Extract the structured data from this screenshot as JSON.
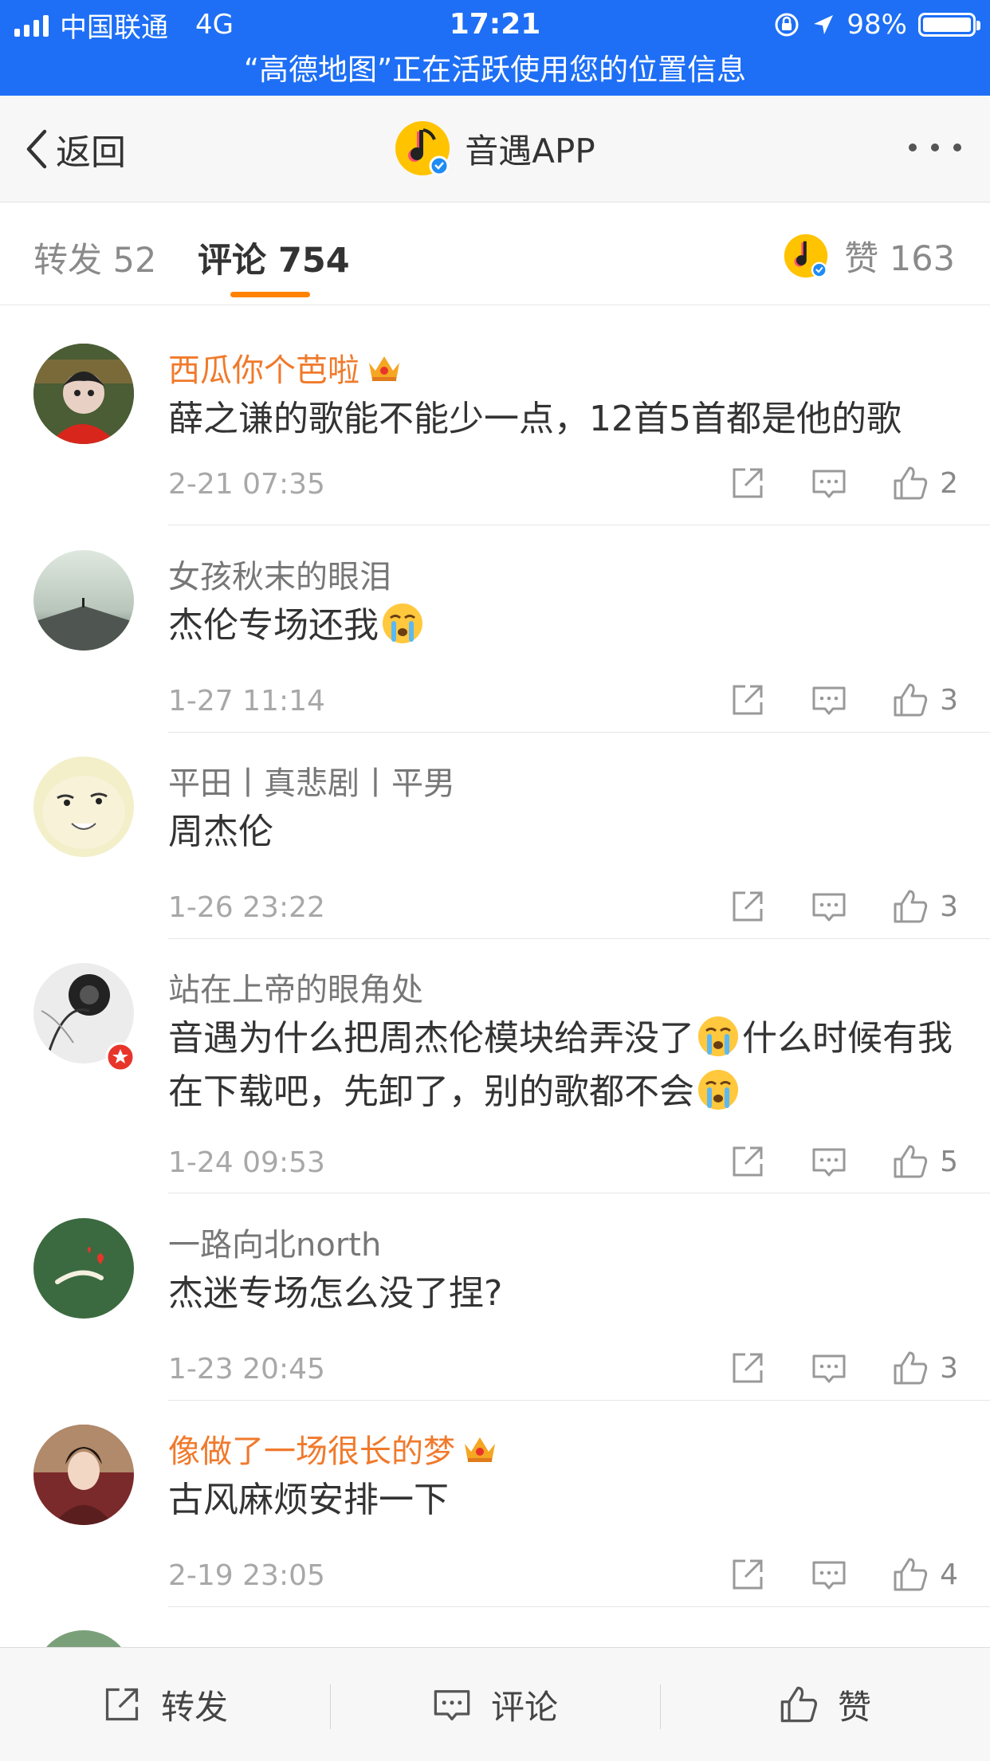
{
  "status_bar": {
    "carrier": "中国联通",
    "network": "4G",
    "time": "17:21",
    "battery": "98%",
    "battery_level": 0.98,
    "banner": "“高德地图”正在活跃使用您的位置信息"
  },
  "nav": {
    "back_label": "返回",
    "title": "音遇APP"
  },
  "tabs": {
    "repost": "转发 52",
    "comments": "评论 754",
    "likes": "赞 163"
  },
  "comments": [
    {
      "name": "西瓜你个芭啦",
      "vip": true,
      "text": "薛之谦的歌能不能少一点，12首5首都是他的歌",
      "time": "2-21 07:35",
      "likes": "2"
    },
    {
      "name": "女孩秋末的眼泪",
      "vip": false,
      "text": "杰伦专场还我",
      "time": "1-27 11:14",
      "likes": "3"
    },
    {
      "name": "平田丨真悲剧丨平男",
      "vip": false,
      "text": "周杰伦",
      "time": "1-26 23:22",
      "likes": "3"
    },
    {
      "name": "站在上帝的眼角处",
      "vip": false,
      "text_a": "音遇为什么把周杰伦模块给弄没了",
      "text_b": "什么时候有我在下载吧，先卸了，别的歌都不会",
      "time": "1-24 09:53",
      "likes": "5"
    },
    {
      "name": "一路向北north",
      "vip": false,
      "text": "杰迷专场怎么没了捏?",
      "time": "1-23 20:45",
      "likes": "3"
    },
    {
      "name": "像做了一场很长的梦",
      "vip": true,
      "text": "古风麻烦安排一下",
      "time": "2-19 23:05",
      "likes": "4"
    }
  ],
  "bottom_bar": {
    "repost": "转发",
    "comment": "评论",
    "like": "赞"
  },
  "colors": {
    "status_blue": "#1e6ff5",
    "accent_orange": "#ff8200",
    "vip_name": "#f07a2c"
  }
}
